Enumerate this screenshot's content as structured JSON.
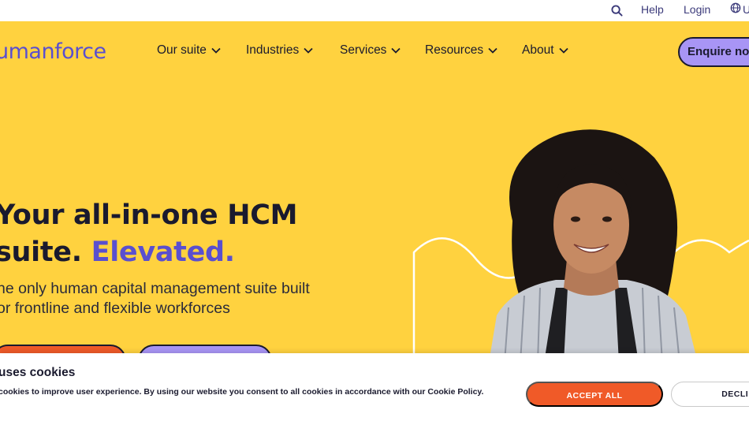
{
  "utility": {
    "search_icon": "search-icon",
    "help_label": "Help",
    "login_label": "Login",
    "region_icon": "globe-icon",
    "region_label": "U"
  },
  "nav": {
    "logo_text": "umanforce",
    "items": [
      {
        "label": "Our suite"
      },
      {
        "label": "Industries"
      },
      {
        "label": "Services"
      },
      {
        "label": "Resources"
      },
      {
        "label": "About"
      }
    ],
    "cta_label": "Enquire no"
  },
  "hero": {
    "title_line1": "Your all-in-one HCM",
    "title_line2_plain": "suite. ",
    "title_line2_accent": "Elevated.",
    "subtitle_line1": "he only human capital management suite built",
    "subtitle_line2": "or frontline and flexible workforces"
  },
  "cookie": {
    "title": "uses cookies",
    "text": "cookies to improve user experience. By using our website you consent to all cookies in accordance with our Cookie Policy.",
    "accept_label": "ACCEPT ALL",
    "decline_label": "DECLINE"
  },
  "colors": {
    "background": "#ffd23f",
    "brand_purple": "#5a4fcf",
    "accent_orange": "#f05a28",
    "lavender": "#a895f5"
  }
}
